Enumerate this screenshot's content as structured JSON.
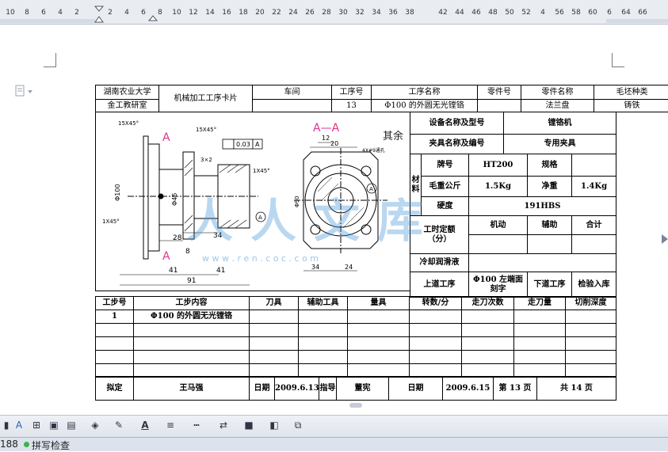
{
  "ruler": {
    "ticks": [
      "10",
      "8",
      "6",
      "4",
      "2",
      "2",
      "4",
      "6",
      "8",
      "10",
      "12",
      "14",
      "16",
      "18",
      "20",
      "22",
      "24",
      "26",
      "28",
      "30",
      "32",
      "34",
      "36",
      "38",
      "42",
      "44",
      "46",
      "48",
      "50",
      "52",
      "4",
      "56",
      "58",
      "60",
      "6",
      "64",
      "66"
    ]
  },
  "card": {
    "school": "湖南农业大学",
    "dept": "金工教研室",
    "title": "机械加工工序卡片",
    "h_workshop": "车间",
    "h_process_no": "工序号",
    "h_process_name": "工序名称",
    "h_part_no": "零件号",
    "h_part_name": "零件名称",
    "h_blank_type": "毛坯种类",
    "v_process_no": "13",
    "v_process_name": "Φ100 的外圆无光镗铬",
    "v_part_name": "法兰盘",
    "v_blank_type": "铸铁",
    "equip_label": "设备名称及型号",
    "equip_value": "镗铬机",
    "fixture_label": "夹具名称及编号",
    "fixture_value": "专用夹具",
    "material_label": "材料",
    "grade_label": "牌号",
    "grade_value": "HT200",
    "spec_label": "规格",
    "rough_weight_label": "毛重公斤",
    "rough_weight_value": "1.5Kg",
    "net_weight_label": "净重",
    "net_weight_value": "1.4Kg",
    "hardness_label": "硬度",
    "hardness_value": "191HBS",
    "time_label": "工时定额（分）",
    "motor_label": "机动",
    "aux_label": "辅助",
    "total_label": "合计",
    "coolant_label": "冷却润滑液",
    "prev_label": "上道工序",
    "prev_value": "Φ100 左端面刻字",
    "next_label": "下道工序",
    "next_value": "检验入库",
    "step_headers": [
      "工步号",
      "工步内容",
      "刀具",
      "辅助工具",
      "量具",
      "转数/分",
      "走刀次数",
      "走刀量",
      "切削深度"
    ],
    "step1_no": "1",
    "step1_content": "Φ100 的外圆无光镗铬",
    "prepared_label": "拟定",
    "prepared_value": "王马强",
    "date_label": "日期",
    "date1": "2009.6.13",
    "guide_label": "指导",
    "guide_value": "董宪",
    "date_label2": "日期",
    "date2": "2009.6.15",
    "page_label": "第 13 页",
    "total_pages_label": "共 14 页"
  },
  "drawing": {
    "section_label": "A—A",
    "marker_a": "A",
    "rest": "其余",
    "tolerance": "0.03",
    "datum": "A",
    "chamfer1": "15X45°",
    "chamfer2": "15X45°",
    "chamfer3": "1X45°",
    "chamfer4": "1X45°",
    "holes": "4X#9通孔",
    "dim_41a": "41",
    "dim_91": "91",
    "dim_41b": "41",
    "dim_34": "34",
    "dim_28": "28",
    "dim_8": "8",
    "dim_20": "20",
    "dim_12": "12",
    "dim_34b": "34",
    "dim_24": "24",
    "dim_d100": "Φ100",
    "dim_d45": "Φ45",
    "dim_d90": "Φ90",
    "dim_3x2": "3×2"
  },
  "watermark": {
    "text": "人人文库",
    "url": "w w w . r e n   . c o c . c o m"
  },
  "status": {
    "page_no": "188",
    "spell_check": "拼写检查"
  },
  "colors": {
    "ruler_bg": "#e9ecf1",
    "watermark": "#3a8fd6",
    "section_marker": "#e0348f",
    "toolbar_bg": "#dfe4ec"
  }
}
